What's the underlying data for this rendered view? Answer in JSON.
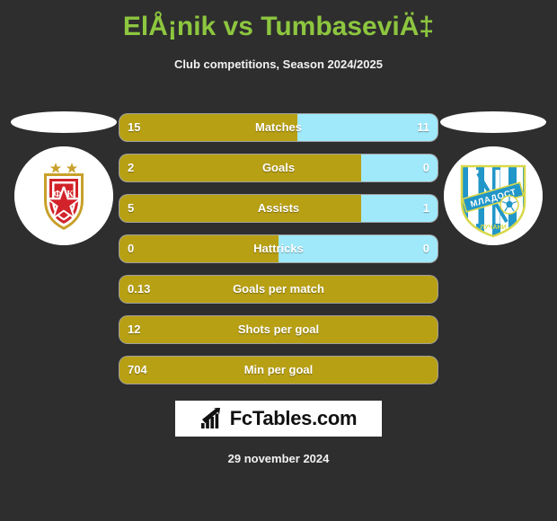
{
  "header": {
    "title": "ElÅ¡nik vs TumbaseviÄ‡",
    "subtitle": "Club competitions, Season 2024/2025",
    "title_color": "#8dc63f"
  },
  "teams": {
    "home": {
      "crest_name": "red-star-belgrade-crest",
      "crest_text": "ФК",
      "colors": {
        "primary": "#d2232a",
        "secondary": "#ffffff",
        "accent": "#c8a02a"
      }
    },
    "away": {
      "crest_name": "mladost-crest",
      "crest_text": "МЛАДОСТ",
      "crest_subtext": "ЛУЧАНИ",
      "colors": {
        "primary": "#2196c9",
        "secondary": "#ffffff",
        "accent": "#d8d84a"
      }
    }
  },
  "colors": {
    "background": "#2e2e2e",
    "home_bar": "#b8a014",
    "away_bar": "#9fe9fb",
    "text": "#ffffff"
  },
  "stats": [
    {
      "label": "Matches",
      "home": "15",
      "away": "11",
      "home_percent": 56,
      "two_sided": true
    },
    {
      "label": "Goals",
      "home": "2",
      "away": "0",
      "home_percent": 76,
      "two_sided": true
    },
    {
      "label": "Assists",
      "home": "5",
      "away": "1",
      "home_percent": 76,
      "two_sided": true
    },
    {
      "label": "Hattricks",
      "home": "0",
      "away": "0",
      "home_percent": 50,
      "two_sided": true
    },
    {
      "label": "Goals per match",
      "home": "0.13",
      "away": "",
      "home_percent": 100,
      "two_sided": false
    },
    {
      "label": "Shots per goal",
      "home": "12",
      "away": "",
      "home_percent": 100,
      "two_sided": false
    },
    {
      "label": "Min per goal",
      "home": "704",
      "away": "",
      "home_percent": 100,
      "two_sided": false
    }
  ],
  "footer": {
    "logo_text": "FcTables.com",
    "logo_icon": "bar-chart-arrow-icon",
    "date": "29 november 2024"
  }
}
